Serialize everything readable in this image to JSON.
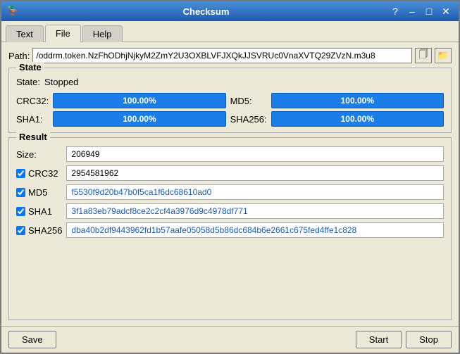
{
  "window": {
    "title": "Checksum",
    "icon": "🦆"
  },
  "title_controls": {
    "help": "?",
    "minimize": "–",
    "maximize": "□",
    "close": "✕"
  },
  "tabs": [
    {
      "label": "Text",
      "active": false
    },
    {
      "label": "File",
      "active": true
    },
    {
      "label": "Help",
      "active": false
    }
  ],
  "path": {
    "label": "Path:",
    "value": "/oddrm.token.NzFhODhjNjkyM2ZmY2U3OXBLVFJXQkJJSVRUc0VnaXVTQ29ZVzN.m3u8",
    "copy_icon": "📋",
    "folder_icon": "📁"
  },
  "state_panel": {
    "title": "State",
    "state_label": "State:",
    "state_value": "Stopped",
    "progress": [
      {
        "label": "CRC32:",
        "value": "100.00%"
      },
      {
        "label": "MD5:",
        "value": "100.00%"
      },
      {
        "label": "SHA1:",
        "value": "100.00%"
      },
      {
        "label": "SHA256:",
        "value": "100.00%"
      }
    ]
  },
  "result_panel": {
    "title": "Result",
    "rows": [
      {
        "label": "Size:",
        "value": "206949",
        "checkbox": false,
        "colored": false
      },
      {
        "label": "CRC32",
        "value": "2954581962",
        "checkbox": true,
        "checked": true,
        "colored": false
      },
      {
        "label": "MD5",
        "value": "f5530f9d20b47b0f5ca1f6dc68610ad0",
        "checkbox": true,
        "checked": true,
        "colored": true
      },
      {
        "label": "SHA1",
        "value": "3f1a83eb79adcf8ce2c2cf4a3976d9c4978df771",
        "checkbox": true,
        "checked": true,
        "colored": true
      },
      {
        "label": "SHA256",
        "value": "dba40b2df9443962fd1b57aafe05058d5b86dc684b6e2661c675fed4ffe1c828",
        "checkbox": true,
        "checked": true,
        "colored": true
      }
    ]
  },
  "buttons": {
    "save": "Save",
    "start": "Start",
    "stop": "Stop"
  }
}
